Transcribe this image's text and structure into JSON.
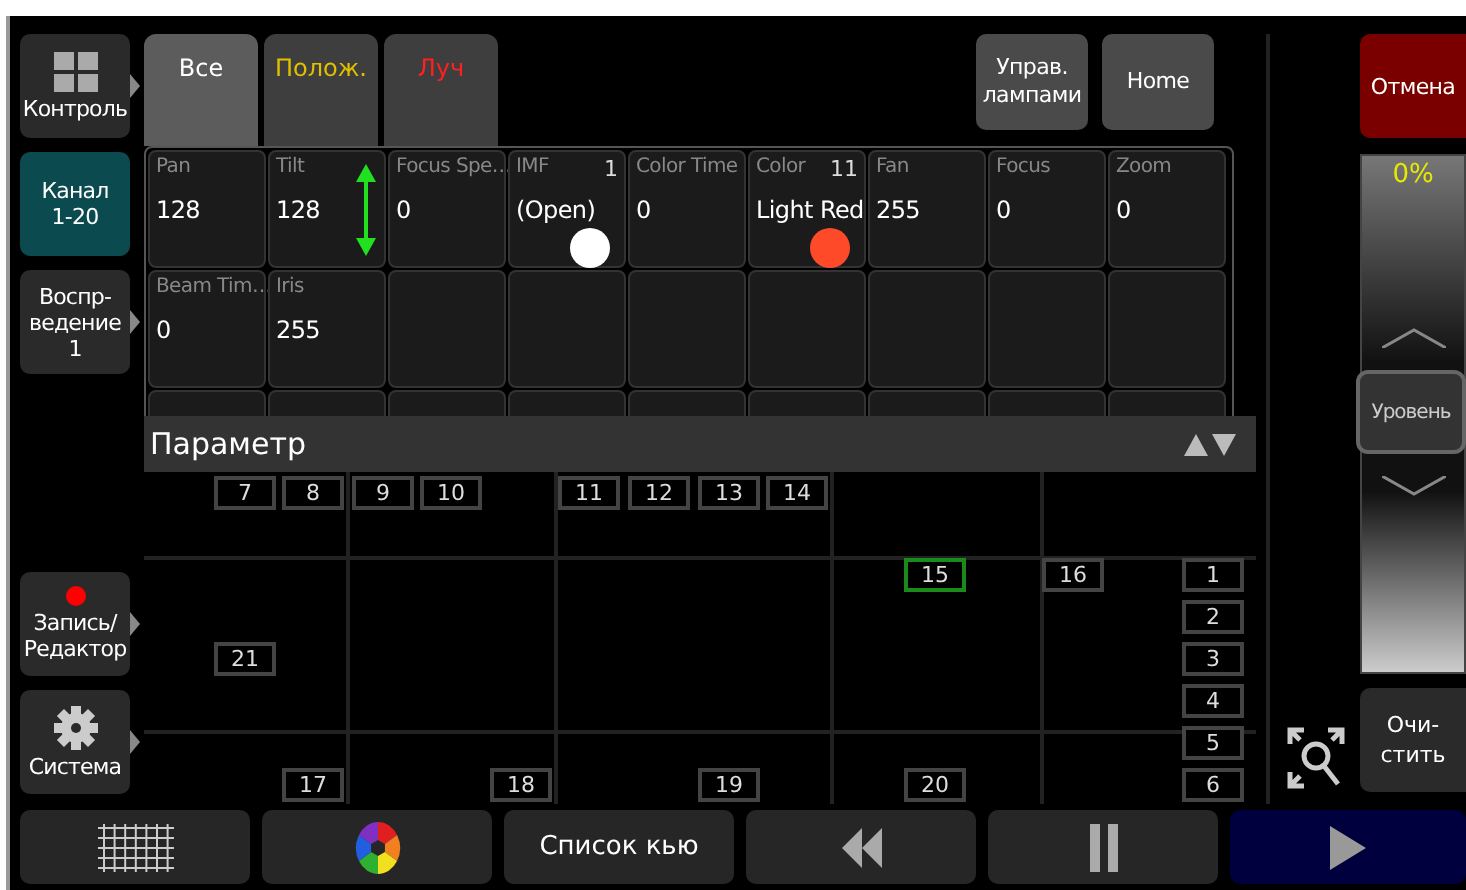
{
  "sidebar": {
    "items": [
      {
        "kind": "grid",
        "label": "Контроль",
        "selected": false,
        "submenu": true
      },
      {
        "kind": "text",
        "label": "Канал\n1-20",
        "selected": true,
        "submenu": false
      },
      {
        "kind": "text",
        "label": "Воспр-\nведение\n1",
        "selected": false,
        "submenu": true
      },
      {
        "kind": "record",
        "label": "Запись/\nРедактор",
        "selected": false,
        "submenu": true
      },
      {
        "kind": "gear",
        "label": "Система",
        "selected": false,
        "submenu": true
      }
    ]
  },
  "tabs": [
    {
      "label": "Все",
      "selected": true,
      "kind": "all"
    },
    {
      "label": "Полож.",
      "selected": false,
      "kind": "position"
    },
    {
      "label": "Луч",
      "selected": false,
      "kind": "beam"
    }
  ],
  "top_buttons": [
    "Управ.\nлампами",
    "Home"
  ],
  "parameters": [
    {
      "kind": "plain",
      "label": "Pan",
      "value": "128"
    },
    {
      "kind": "tilt",
      "label": "Tilt",
      "value": "128"
    },
    {
      "kind": "plain",
      "label": "Focus Spe…",
      "value": "0"
    },
    {
      "kind": "swatch",
      "label": "IMF",
      "number": "1",
      "value": "(Open)",
      "color": "#ffffff"
    },
    {
      "kind": "plain",
      "label": "Color Time",
      "value": "0"
    },
    {
      "kind": "swatch",
      "label": "Color",
      "number": "11",
      "value": "Light Red",
      "color": "#ff4a2a"
    },
    {
      "kind": "plain",
      "label": "Fan",
      "value": "255"
    },
    {
      "kind": "plain",
      "label": "Focus",
      "value": "0"
    },
    {
      "kind": "plain",
      "label": "Zoom",
      "value": "0"
    },
    {
      "kind": "plain",
      "label": "Beam Tim…",
      "value": "0"
    },
    {
      "kind": "plain",
      "label": "Iris",
      "value": "255"
    }
  ],
  "parameter_bar": {
    "title": "Параметр"
  },
  "fixtures": [
    {
      "label": "7",
      "selected": false
    },
    {
      "label": "8",
      "selected": false
    },
    {
      "label": "9",
      "selected": false
    },
    {
      "label": "10",
      "selected": false
    },
    {
      "label": "11",
      "selected": false
    },
    {
      "label": "12",
      "selected": false
    },
    {
      "label": "13",
      "selected": false
    },
    {
      "label": "14",
      "selected": false
    },
    {
      "label": "15",
      "selected": true
    },
    {
      "label": "16",
      "selected": false
    },
    {
      "label": "1",
      "selected": false
    },
    {
      "label": "2",
      "selected": false
    },
    {
      "label": "21",
      "selected": false
    },
    {
      "label": "3",
      "selected": false
    },
    {
      "label": "4",
      "selected": false
    },
    {
      "label": "5",
      "selected": false
    },
    {
      "label": "17",
      "selected": false
    },
    {
      "label": "18",
      "selected": false
    },
    {
      "label": "19",
      "selected": false
    },
    {
      "label": "20",
      "selected": false
    },
    {
      "label": "6",
      "selected": false
    }
  ],
  "right_panel": {
    "cancel": "Отмена",
    "fader_reading": "0%",
    "fader_handle": "Уровень",
    "clear": "Очи-\nстить"
  },
  "bottom_bar": [
    {
      "kind": "grid",
      "selected": false
    },
    {
      "kind": "wheel",
      "selected": false
    },
    {
      "kind": "text",
      "label": "Список кью",
      "selected": false
    },
    {
      "kind": "rewind",
      "selected": false
    },
    {
      "kind": "pause",
      "selected": false
    },
    {
      "kind": "play",
      "selected": true
    }
  ]
}
